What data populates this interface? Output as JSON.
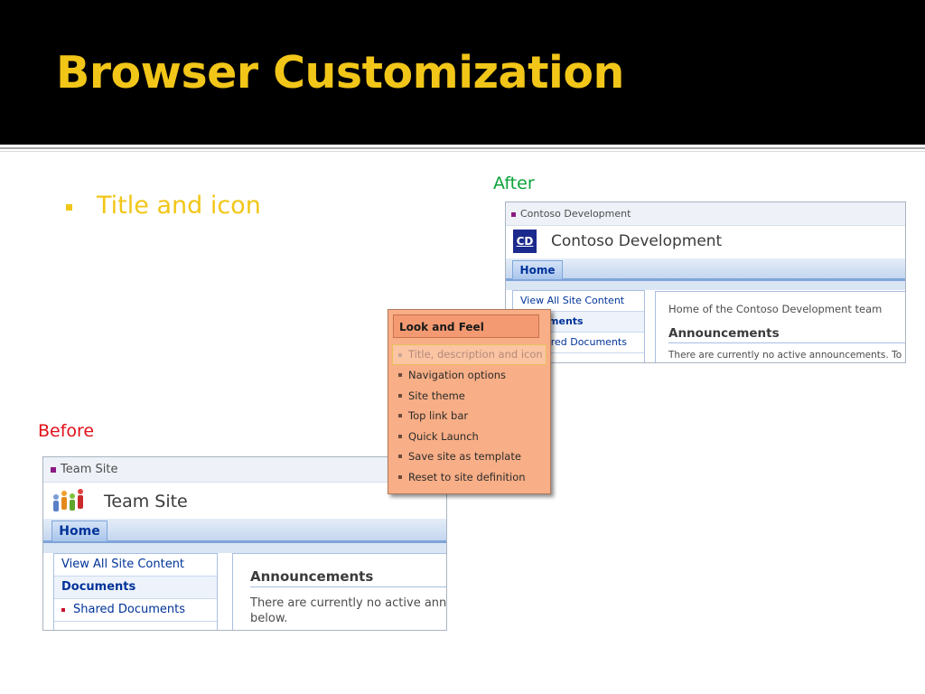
{
  "slide": {
    "title": "Browser Customization",
    "bullet": "Title and icon",
    "label_after": "After",
    "label_before": "Before",
    "colors": {
      "title": "#f2c618",
      "after_label": "#0ba339",
      "before_label": "#e1101a",
      "menu_bg": "#f8ae86"
    }
  },
  "after": {
    "breadcrumb": "Contoso Development",
    "logo_text": "CD",
    "site_title": "Contoso Development",
    "home_tab": "Home",
    "quick_launch": [
      "View All Site Content",
      "Documents",
      "Shared Documents"
    ],
    "home_description": "Home of the Contoso Development team",
    "announcements_title": "Announcements",
    "announcements_text": "There are currently no active announcements. To"
  },
  "before": {
    "breadcrumb": "Team Site",
    "site_title": "Team Site",
    "home_tab": "Home",
    "quick_launch": [
      "View All Site Content",
      "Documents",
      "Shared Documents"
    ],
    "announcements_title": "Announcements",
    "announcements_text": "There are currently no active ann below."
  },
  "menu": {
    "header": "Look and Feel",
    "items": [
      "Title, description and icon",
      "Navigation options",
      "Site theme",
      "Top link bar",
      "Quick Launch",
      "Save site as template",
      "Reset to site definition"
    ],
    "selected_index": 0
  }
}
